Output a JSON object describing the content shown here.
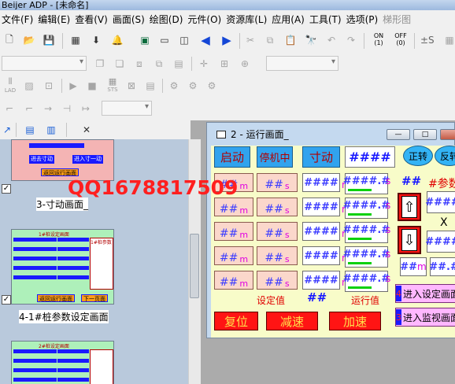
{
  "app": {
    "title": "Beijer ADP - [未命名]"
  },
  "menu": [
    {
      "label": "文件(F)",
      "disabled": false
    },
    {
      "label": "编辑(E)",
      "disabled": false
    },
    {
      "label": "查看(V)",
      "disabled": false
    },
    {
      "label": "画面(S)",
      "disabled": false
    },
    {
      "label": "绘图(D)",
      "disabled": false
    },
    {
      "label": "元件(O)",
      "disabled": false
    },
    {
      "label": "资源库(L)",
      "disabled": false
    },
    {
      "label": "应用(A)",
      "disabled": false
    },
    {
      "label": "工具(T)",
      "disabled": false
    },
    {
      "label": "选项(P)",
      "disabled": false
    },
    {
      "label": "梯形图",
      "disabled": true
    }
  ],
  "toolbar": {
    "onoff_on": "ON",
    "onoff_off": "OFF",
    "onoff_on_sub": "(1)",
    "onoff_off_sub": "(0)",
    "pm": "±S",
    "lad": "LAD",
    "sts": "STS"
  },
  "watermark": "QQ1678817509",
  "thumbnails": [
    {
      "caption": "3-寸动画面_",
      "checked": true
    },
    {
      "caption": "4-1#桩参数设定画面",
      "checked": true
    },
    {
      "caption": "",
      "checked": false
    }
  ],
  "thumb_texts": {
    "t1_a": "进去寸动",
    "t1_b": "进入寸一动",
    "t1_c": "返回运行画面",
    "t2_title": "1#桩设定画面",
    "t2_side": "1#桩参数",
    "t2_back": "返回运行画面",
    "t2_next": "下一页面",
    "t3_title": "2#桩设定画面"
  },
  "window": {
    "title": "2 - 运行画面_",
    "btn_min": "—",
    "btn_max": "□"
  },
  "screen": {
    "top_buttons": [
      "启动",
      "停机中",
      "寸动",
      "####"
    ],
    "oval_forward": "正转",
    "oval_reverse": "反转",
    "right_hash": "##",
    "right_param": "#参数",
    "rows": [
      {
        "pk1": "##",
        "u1": "m",
        "pk2": "##",
        "u2": "s",
        "wh": "####",
        "u3": "r",
        "gh": "####.#",
        "u4": "s"
      },
      {
        "pk1": "##",
        "u1": "m",
        "pk2": "##",
        "u2": "s",
        "wh": "####",
        "u3": "r",
        "gh": "####.#",
        "u4": "s"
      },
      {
        "pk1": "##",
        "u1": "m",
        "pk2": "##",
        "u2": "s",
        "wh": "####",
        "u3": "r",
        "gh": "####.#",
        "u4": "s"
      },
      {
        "pk1": "##",
        "u1": "m",
        "pk2": "##",
        "u2": "s",
        "wh": "####",
        "u3": "r",
        "gh": "####.#",
        "u4": "s"
      },
      {
        "pk1": "##",
        "u1": "m",
        "pk2": "##",
        "u2": "s",
        "wh": "####",
        "u3": "r",
        "gh": "####.#",
        "u4": "s"
      }
    ],
    "right_box1": "####",
    "right_x": "X",
    "right_box2": "####",
    "right_small1": "##",
    "right_small1_u": "m",
    "right_small2": "##.#",
    "setvalue_label": "设定值",
    "hash_label": "##",
    "runvalue_label": "运行值",
    "bottom_buttons": [
      "复位",
      "减速",
      "加速"
    ],
    "nav_buttons": [
      {
        "num": "4",
        "label": "进入设定画面"
      },
      {
        "num": "3",
        "label": "进入监视画面"
      }
    ]
  }
}
